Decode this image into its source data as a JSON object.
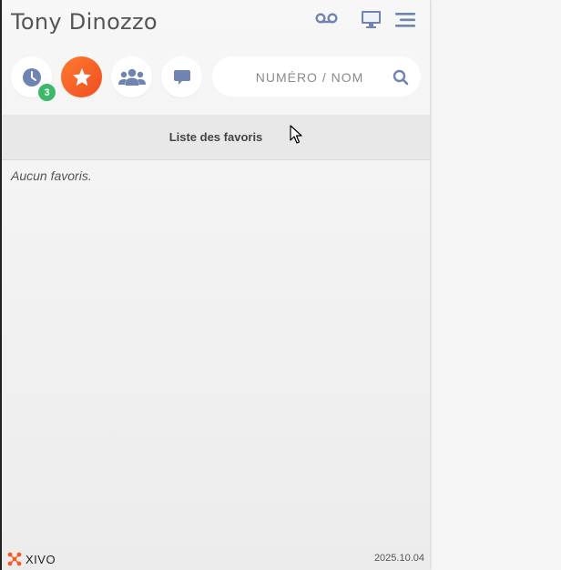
{
  "header": {
    "user_name": "Tony Dinozzo",
    "icons": [
      "voicemail-icon",
      "monitor-icon",
      "menu-icon"
    ]
  },
  "nav": {
    "buttons": [
      {
        "name": "history",
        "icon": "clock-icon",
        "active": false
      },
      {
        "name": "favorites",
        "icon": "star-icon",
        "active": true
      },
      {
        "name": "contacts",
        "icon": "users-icon",
        "active": false
      },
      {
        "name": "chat",
        "icon": "chat-icon",
        "active": false
      }
    ],
    "history_badge": "3"
  },
  "search": {
    "placeholder": "NUMÉRO / NOM",
    "value": ""
  },
  "favorites": {
    "title": "Liste des favoris",
    "empty_message": "Aucun favoris."
  },
  "footer": {
    "brand": "XIVO",
    "version": "2025.10.04"
  },
  "colors": {
    "accent": "#f35a24",
    "icon": "#6f84b0",
    "badge": "#3cb868"
  }
}
